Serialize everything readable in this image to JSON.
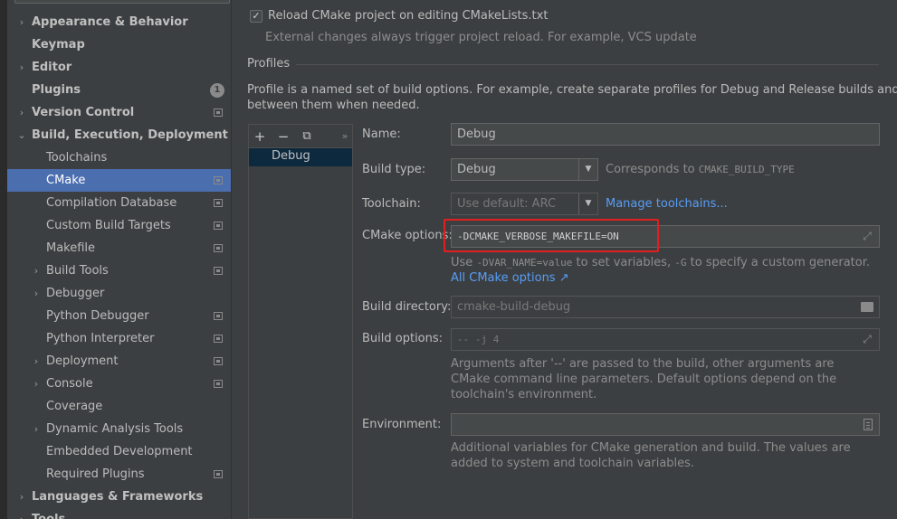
{
  "sidebar": {
    "items": [
      {
        "label": "Appearance & Behavior",
        "level": 0,
        "arrow": "›"
      },
      {
        "label": "Keymap",
        "level": 0
      },
      {
        "label": "Editor",
        "level": 0,
        "arrow": "›"
      },
      {
        "label": "Plugins",
        "level": 0,
        "badge": "1"
      },
      {
        "label": "Version Control",
        "level": 0,
        "arrow": "›"
      },
      {
        "label": "Build, Execution, Deployment",
        "level": 0,
        "arrow": "⌄"
      },
      {
        "label": "Toolchains",
        "level": 1
      },
      {
        "label": "CMake",
        "level": 1,
        "selected": true
      },
      {
        "label": "Compilation Database",
        "level": 1
      },
      {
        "label": "Custom Build Targets",
        "level": 1
      },
      {
        "label": "Makefile",
        "level": 1
      },
      {
        "label": "Build Tools",
        "level": 1,
        "arrow": "›"
      },
      {
        "label": "Debugger",
        "level": 1,
        "arrow": "›"
      },
      {
        "label": "Python Debugger",
        "level": 1
      },
      {
        "label": "Python Interpreter",
        "level": 1
      },
      {
        "label": "Deployment",
        "level": 1,
        "arrow": "›"
      },
      {
        "label": "Console",
        "level": 1,
        "arrow": "›"
      },
      {
        "label": "Coverage",
        "level": 1
      },
      {
        "label": "Dynamic Analysis Tools",
        "level": 1,
        "arrow": "›"
      },
      {
        "label": "Embedded Development",
        "level": 1
      },
      {
        "label": "Required Plugins",
        "level": 1
      },
      {
        "label": "Languages & Frameworks",
        "level": 0,
        "arrow": "›"
      },
      {
        "label": "Tools",
        "level": 0,
        "arrow": "›"
      }
    ]
  },
  "main": {
    "reload_checkbox_label": "Reload CMake project on editing CMakeLists.txt",
    "reload_checked": "✓",
    "reload_note": "External changes always trigger project reload. For example, VCS update",
    "profiles_header": "Profiles",
    "profiles_desc_1": "Profile is a named set of build options. For example, create separate profiles for Debug and Release builds and switch",
    "profiles_desc_2": "between them when needed.",
    "toolbar": {
      "add": "+",
      "remove": "−",
      "copy": "⧉",
      "more": "»"
    },
    "profiles": [
      "Debug"
    ],
    "name_label": "Name:",
    "name_value": "Debug",
    "build_type_label": "Build type:",
    "build_type_value": "Debug",
    "build_type_note": "Corresponds to",
    "build_type_var": "CMAKE_BUILD_TYPE",
    "toolchain_label": "Toolchain:",
    "toolchain_value": "Use default: ARC",
    "manage_toolchains": "Manage toolchains...",
    "cmake_options_label": "CMake options:",
    "cmake_options_value": "-DCMAKE_VERBOSE_MAKEFILE=ON",
    "cmake_hint_use": "Use",
    "cmake_hint_var": "-DVAR_NAME=value",
    "cmake_hint_mid": "to set variables,",
    "cmake_hint_g": "-G",
    "cmake_hint_end": "to specify a custom generator.",
    "all_cmake_options": "All CMake options ↗",
    "build_dir_label": "Build directory:",
    "build_dir_placeholder": "cmake-build-debug",
    "build_options_label": "Build options:",
    "build_options_placeholder": "-- -j 4",
    "build_options_note_1": "Arguments after '--' are passed to the build, other arguments are",
    "build_options_note_2": "CMake command line parameters. Default options depend on the",
    "build_options_note_3": "toolchain's environment.",
    "environment_label": "Environment:",
    "environment_note_1": "Additional variables for CMake generation and build. The values are",
    "environment_note_2": "added to system and toolchain variables."
  },
  "colors": {
    "selection": "#4b6eaf",
    "link": "#589df6",
    "highlight": "#e02020"
  }
}
